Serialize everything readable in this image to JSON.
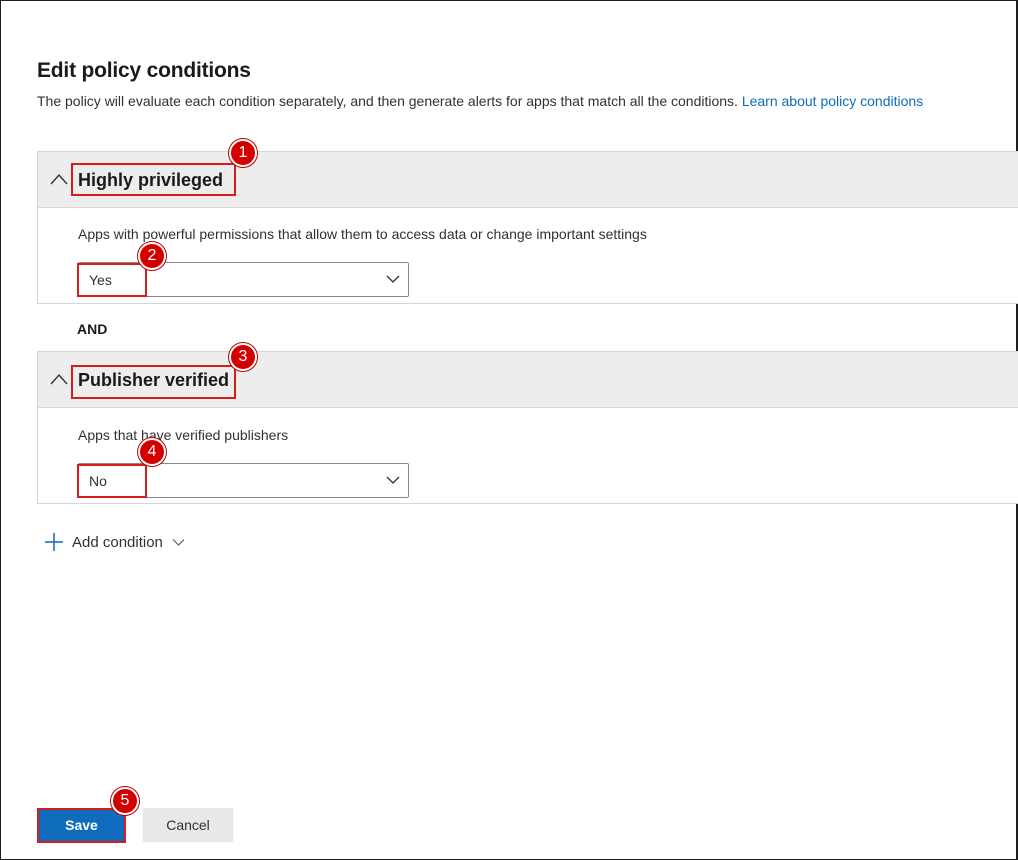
{
  "header": {
    "title": "Edit policy conditions",
    "subtitle": "The policy will evaluate each condition separately, and then generate alerts for apps that match all the conditions.",
    "learn_link": "Learn about policy conditions"
  },
  "conditions": [
    {
      "title": "Highly privileged",
      "description": "Apps with powerful permissions that allow them to access data or change important settings",
      "value": "Yes"
    },
    {
      "title": "Publisher verified",
      "description": "Apps that have verified publishers",
      "value": "No"
    }
  ],
  "operator": "AND",
  "add_condition": {
    "label": "Add condition"
  },
  "footer": {
    "save_label": "Save",
    "cancel_label": "Cancel"
  },
  "annotations": [
    "1",
    "2",
    "3",
    "4",
    "5"
  ],
  "colors": {
    "accent": "#0f6cbd",
    "annotation": "#d40000",
    "header_bg": "#ededed"
  },
  "icons": {
    "collapse": "chevron-up-icon",
    "dropdown": "chevron-down-icon",
    "add": "plus-icon"
  }
}
